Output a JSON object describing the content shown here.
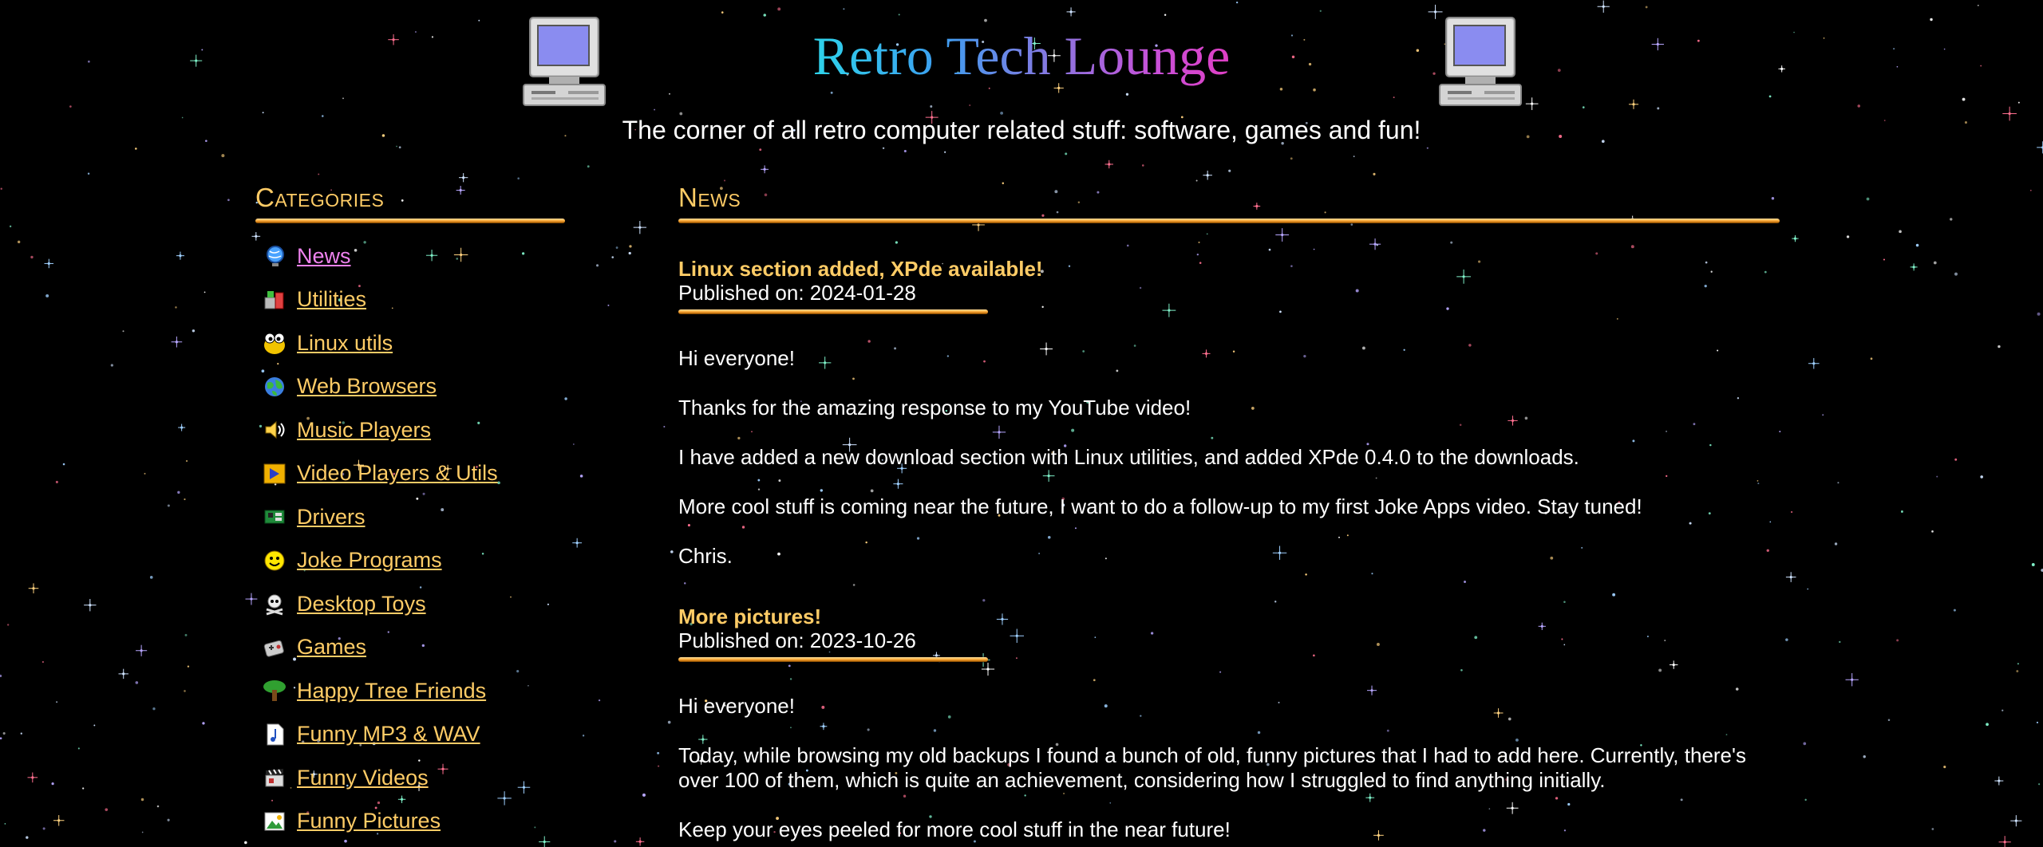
{
  "header": {
    "title": "Retro Tech Lounge",
    "tagline": "The corner of all retro computer related stuff: software, games and fun!",
    "left_icon": "retro-computer-icon",
    "right_icon": "retro-computer-icon"
  },
  "sidebar": {
    "heading": "Categories",
    "items": [
      {
        "label": "News",
        "icon": "globe-icon",
        "active": true
      },
      {
        "label": "Utilities",
        "icon": "tools-icon"
      },
      {
        "label": "Linux utils",
        "icon": "tux-icon"
      },
      {
        "label": "Web Browsers",
        "icon": "earth-icon"
      },
      {
        "label": "Music Players",
        "icon": "speaker-icon"
      },
      {
        "label": "Video Players & Utils",
        "icon": "play-icon"
      },
      {
        "label": "Drivers",
        "icon": "chip-icon"
      },
      {
        "label": "Joke Programs",
        "icon": "smiley-icon"
      },
      {
        "label": "Desktop Toys",
        "icon": "skull-icon"
      },
      {
        "label": "Games",
        "icon": "gamepad-icon"
      },
      {
        "label": "Happy Tree Friends",
        "icon": "tree-icon"
      },
      {
        "label": "Funny MP3 & WAV",
        "icon": "music-note-icon"
      },
      {
        "label": "Funny Videos",
        "icon": "clapper-icon"
      },
      {
        "label": "Funny Pictures",
        "icon": "picture-icon"
      }
    ]
  },
  "main": {
    "heading": "News",
    "posts": [
      {
        "title": "Linux section added, XPde available!",
        "date": "Published on: 2024-01-28",
        "paragraphs": [
          "Hi everyone!",
          "Thanks for the amazing response to my YouTube video!",
          "I have added a new download section with Linux utilities, and added XPde 0.4.0 to the downloads.",
          "More cool stuff is coming near the future, I want to do a follow-up to my first Joke Apps video. Stay tuned!",
          "Chris."
        ]
      },
      {
        "title": "More pictures!",
        "date": "Published on: 2023-10-26",
        "paragraphs": [
          "Hi everyone!",
          "Today, while browsing my old backups I found a bunch of old, funny pictures that I had to add here. Currently, there's over 100 of them, which is quite an achievement, considering how I struggled to find anything initially.",
          "Keep your eyes peeled for more cool stuff in the near future!"
        ]
      }
    ]
  },
  "colors": {
    "background": "#000000",
    "link": "#ffcc66",
    "link_active": "#ee82ee",
    "bar_gold": "#ffb347",
    "text": "#ffffff"
  }
}
